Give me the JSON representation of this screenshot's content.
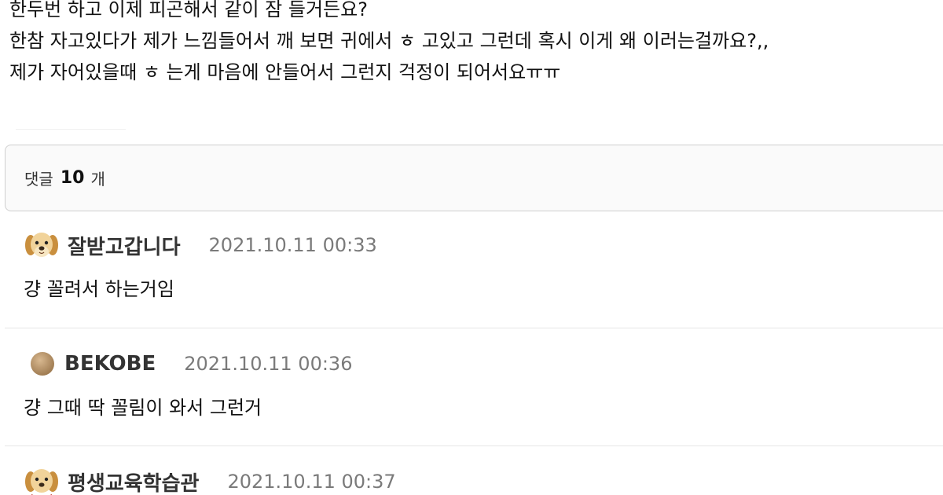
{
  "post": {
    "lines": [
      "한두번 하고 이제 피곤해서 같이 잠 들거든요?",
      "한참 자고있다가 제가 느낌들어서 깨 보면 귀에서 ㅎ 고있고 그런데 혹시 이게 왜 이러는걸까요?,,",
      "제가 자어있을때 ㅎ 는게 마음에 안들어서 그런지 걱정이 되어서요ㅠㅠ"
    ]
  },
  "comments_header": {
    "label": "댓글",
    "count": "10",
    "unit": "개"
  },
  "comments": [
    {
      "avatar_icon": "puppy-icon",
      "author": "잘받고갑니다",
      "timestamp": "2021.10.11 00:33",
      "text": "걍 꼴려서 하는거임"
    },
    {
      "avatar_icon": "brown-ball-icon",
      "author": "BEKOBE",
      "timestamp": "2021.10.11 00:36",
      "text": "걍 그때 딱 꼴림이 와서 그런거"
    },
    {
      "avatar_icon": "puppy-icon",
      "author": "평생교육학습관",
      "timestamp": "2021.10.11 00:37",
      "text": ""
    }
  ],
  "colors": {
    "timestamp": "#7a7a7a",
    "header_border": "#cfcfcf",
    "separator": "#e6e6e6"
  }
}
